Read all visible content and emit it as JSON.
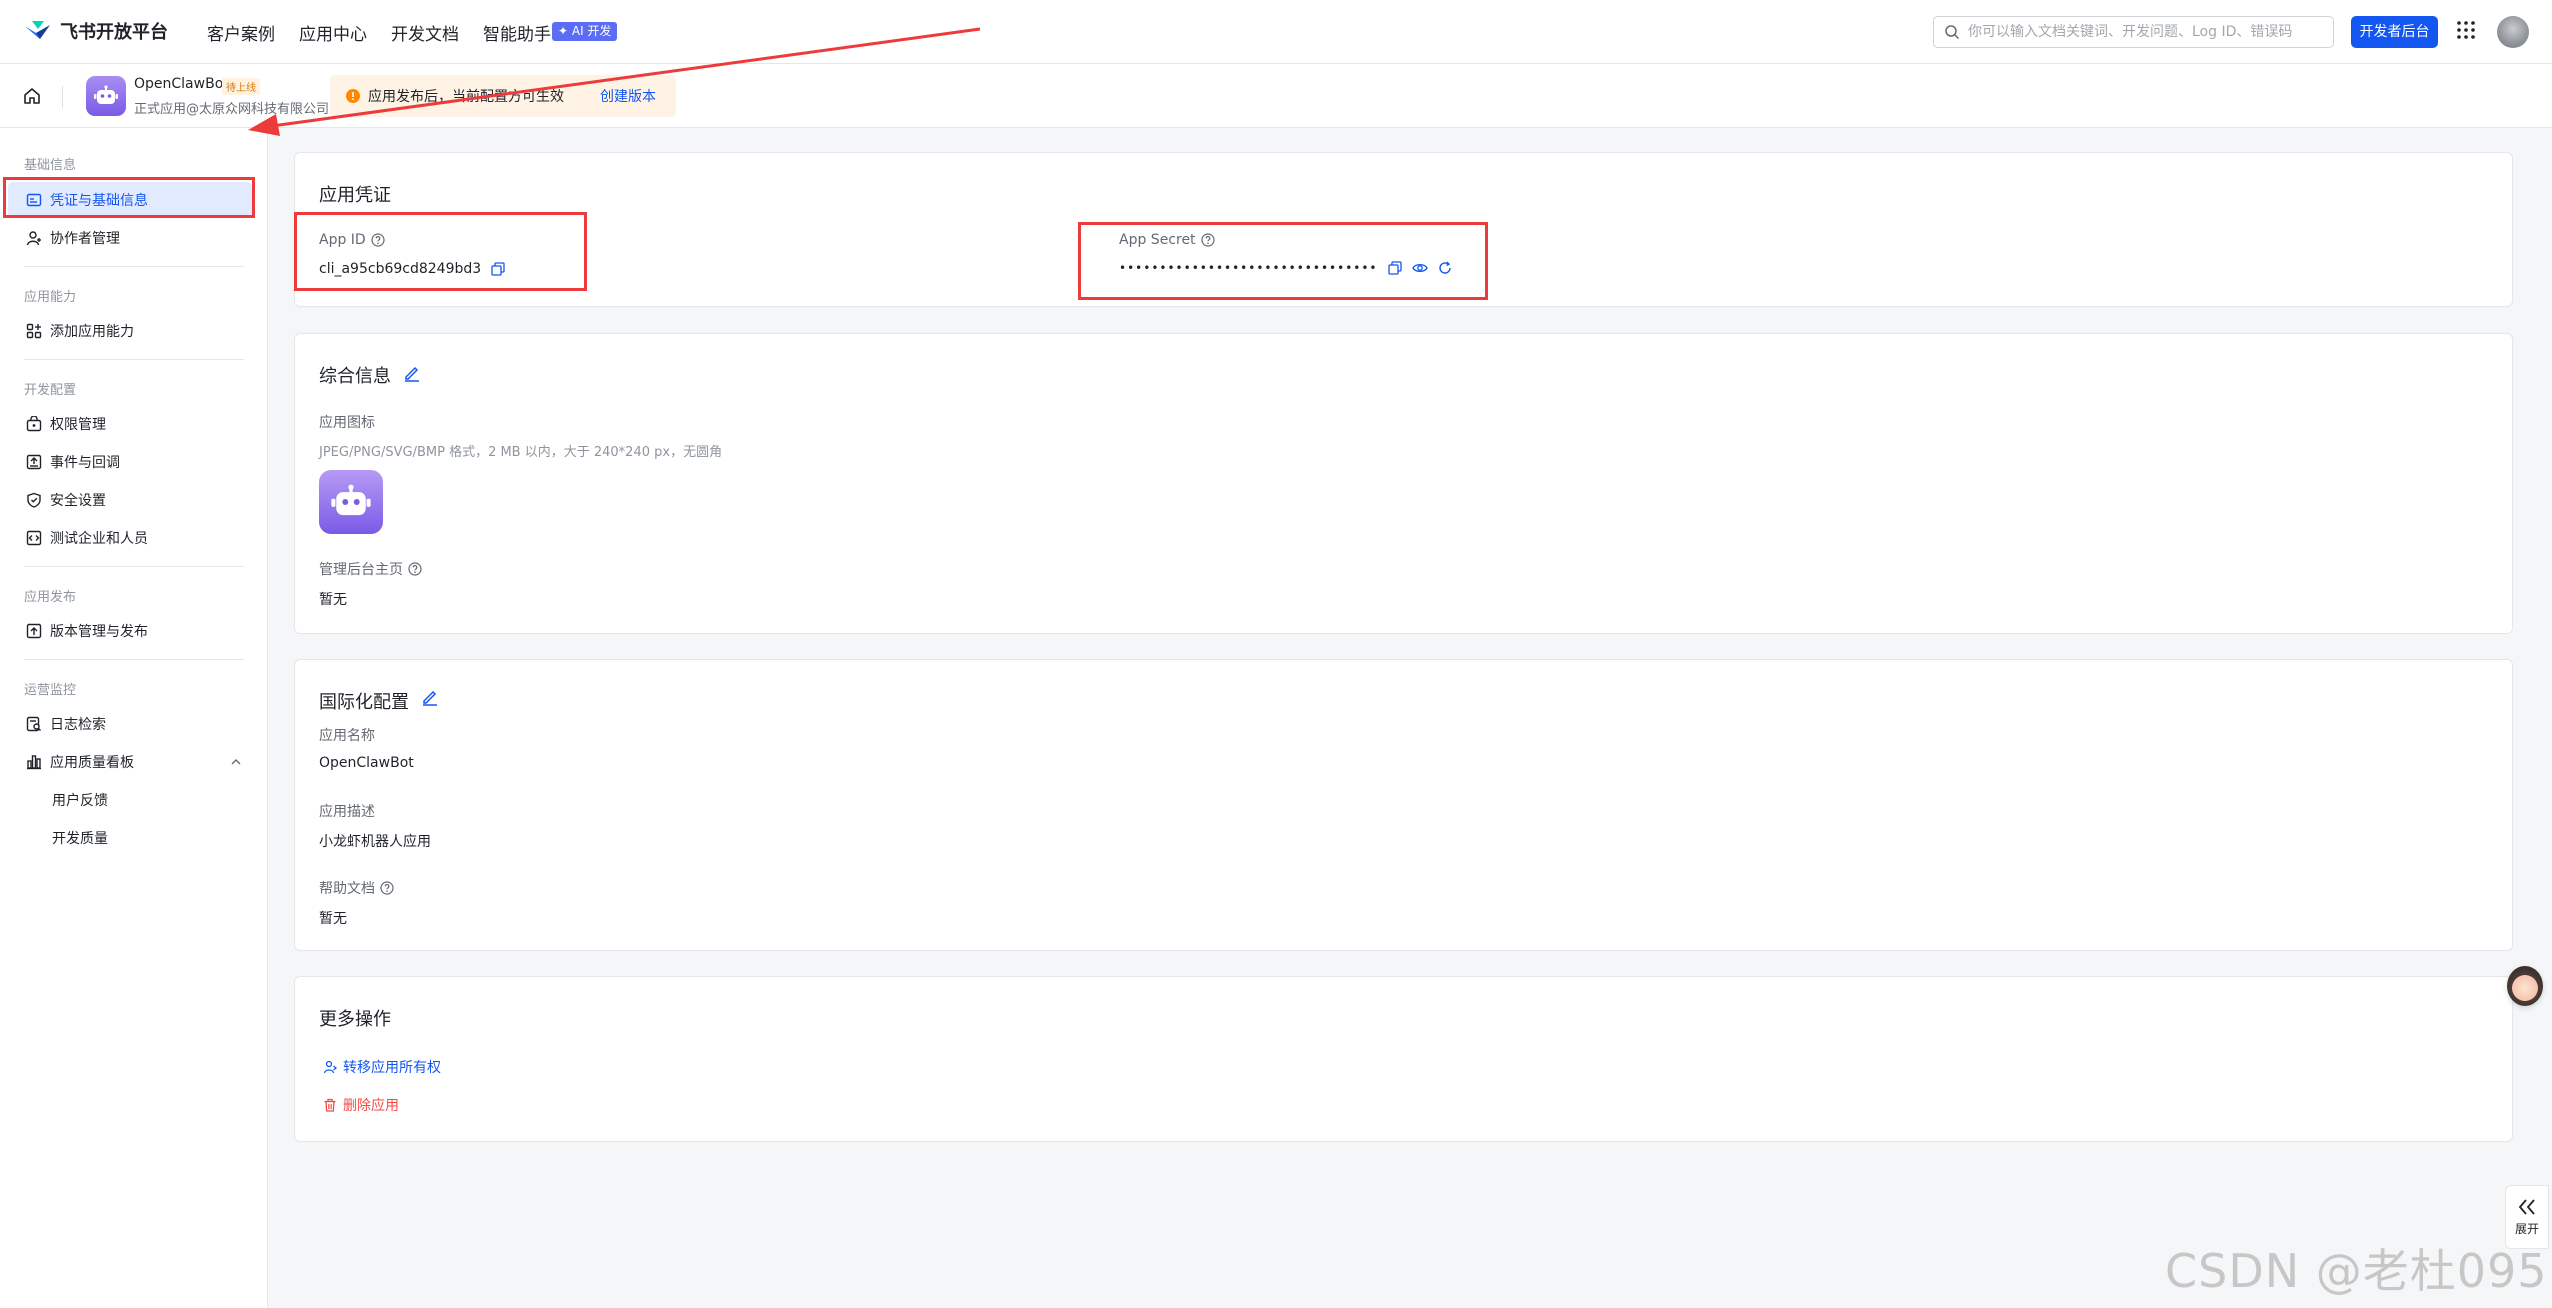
{
  "topnav": {
    "brand": "飞书开放平台",
    "links": [
      "客户案例",
      "应用中心",
      "开发文档",
      "智能助手"
    ],
    "ai_badge": "✦ AI 开发",
    "search_placeholder": "你可以输入文档关键词、开发问题、Log ID、错误码",
    "dev_button": "开发者后台"
  },
  "subheader": {
    "app_name": "OpenClawBot",
    "status": "待上线",
    "app_org": "正式应用@太原众网科技有限公司",
    "notice": "应用发布后，当前配置方可生效",
    "notice_link": "创建版本"
  },
  "sidebar": {
    "groups": [
      "基础信息",
      "应用能力",
      "开发配置",
      "应用发布",
      "运营监控"
    ],
    "items": {
      "credentials": "凭证与基础信息",
      "collaborators": "协作者管理",
      "add_capability": "添加应用能力",
      "permissions": "权限管理",
      "events": "事件与回调",
      "security": "安全设置",
      "test_org": "测试企业和人员",
      "versions": "版本管理与发布",
      "logs": "日志检索",
      "quality": "应用质量看板",
      "feedback": "用户反馈",
      "dev_quality": "开发质量"
    }
  },
  "credentials": {
    "title": "应用凭证",
    "app_id_label": "App ID",
    "app_id": "cli_a95cb69cd8249bd3",
    "app_secret_label": "App Secret",
    "app_secret": "••••••••••••••••••••••••••••••••"
  },
  "general": {
    "title": "综合信息",
    "icon_label": "应用图标",
    "icon_hint": "JPEG/PNG/SVG/BMP 格式，2 MB 以内，大于 240*240 px，无圆角",
    "admin_label": "管理后台主页",
    "admin_value": "暂无"
  },
  "i18n": {
    "title": "国际化配置",
    "name_label": "应用名称",
    "name_value": "OpenClawBot",
    "desc_label": "应用描述",
    "desc_value": "小龙虾机器人应用",
    "help_label": "帮助文档",
    "help_value": "暂无"
  },
  "more": {
    "title": "更多操作",
    "transfer": "转移应用所有权",
    "delete": "删除应用"
  },
  "expand_label": "展开",
  "watermark": "CSDN @老杜095",
  "colors": {
    "primary": "#1456f0",
    "danger": "#f54a45",
    "annotation": "#ec3b3b"
  }
}
